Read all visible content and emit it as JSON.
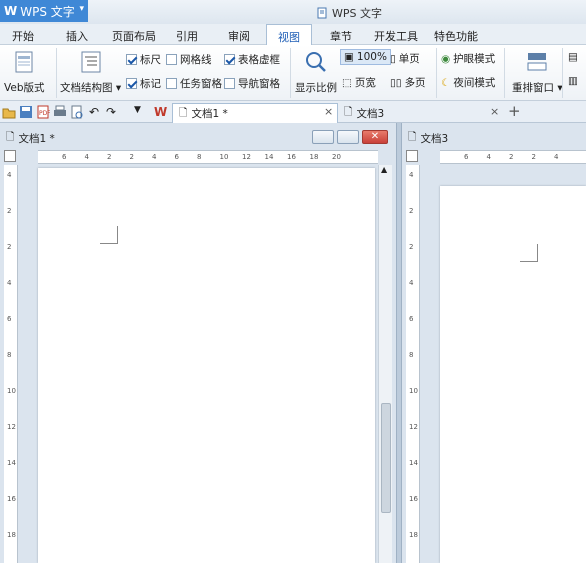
{
  "app": {
    "name": "WPS 文字",
    "window_title": "WPS 文字"
  },
  "menu": [
    {
      "label": "开始"
    },
    {
      "label": "插入"
    },
    {
      "label": "页面布局"
    },
    {
      "label": "引用"
    },
    {
      "label": "审阅"
    },
    {
      "label": "视图",
      "active": true
    },
    {
      "label": "章节"
    },
    {
      "label": "开发工具"
    },
    {
      "label": "特色功能"
    }
  ],
  "ribbon": {
    "web_layout": "Veb版式",
    "doc_structure": "文档结构图",
    "ruler": "标尺",
    "marks": "标记",
    "gridlines": "网格线",
    "task_pane": "任务窗格",
    "table_gridlines": "表格虚框",
    "nav_pane": "导航窗格",
    "zoom_label": "显示比例",
    "zoom_value": "100%",
    "page_width": "页宽",
    "single_page": "单页",
    "multi_page": "多页",
    "eye_mode": "护眼模式",
    "night_mode": "夜间模式",
    "arrange_window": "重排窗口"
  },
  "checks": {
    "ruler": true,
    "marks": true,
    "gridlines": false,
    "task_pane": false,
    "table_gridlines": true,
    "nav_pane": false
  },
  "tabs": [
    {
      "label": "文档1 *",
      "active": true
    },
    {
      "label": "文档3",
      "active": false
    }
  ],
  "new_tab": "+",
  "panes": [
    {
      "title": "文档1 *"
    },
    {
      "title": "文档3"
    }
  ],
  "ruler_h_left": [
    "6",
    "4",
    "2",
    "2",
    "4",
    "6",
    "8",
    "10",
    "12",
    "14",
    "16",
    "18",
    "20"
  ],
  "ruler_h_right": [
    "6",
    "4",
    "2",
    "2",
    "4"
  ],
  "ruler_v": [
    "4",
    "2",
    "2",
    "4",
    "6",
    "8",
    "10",
    "12",
    "14",
    "16",
    "18"
  ],
  "colors": {
    "accent": "#3f88d6",
    "active_menu": "#1d5db5",
    "close_btn": "#c9413a"
  }
}
